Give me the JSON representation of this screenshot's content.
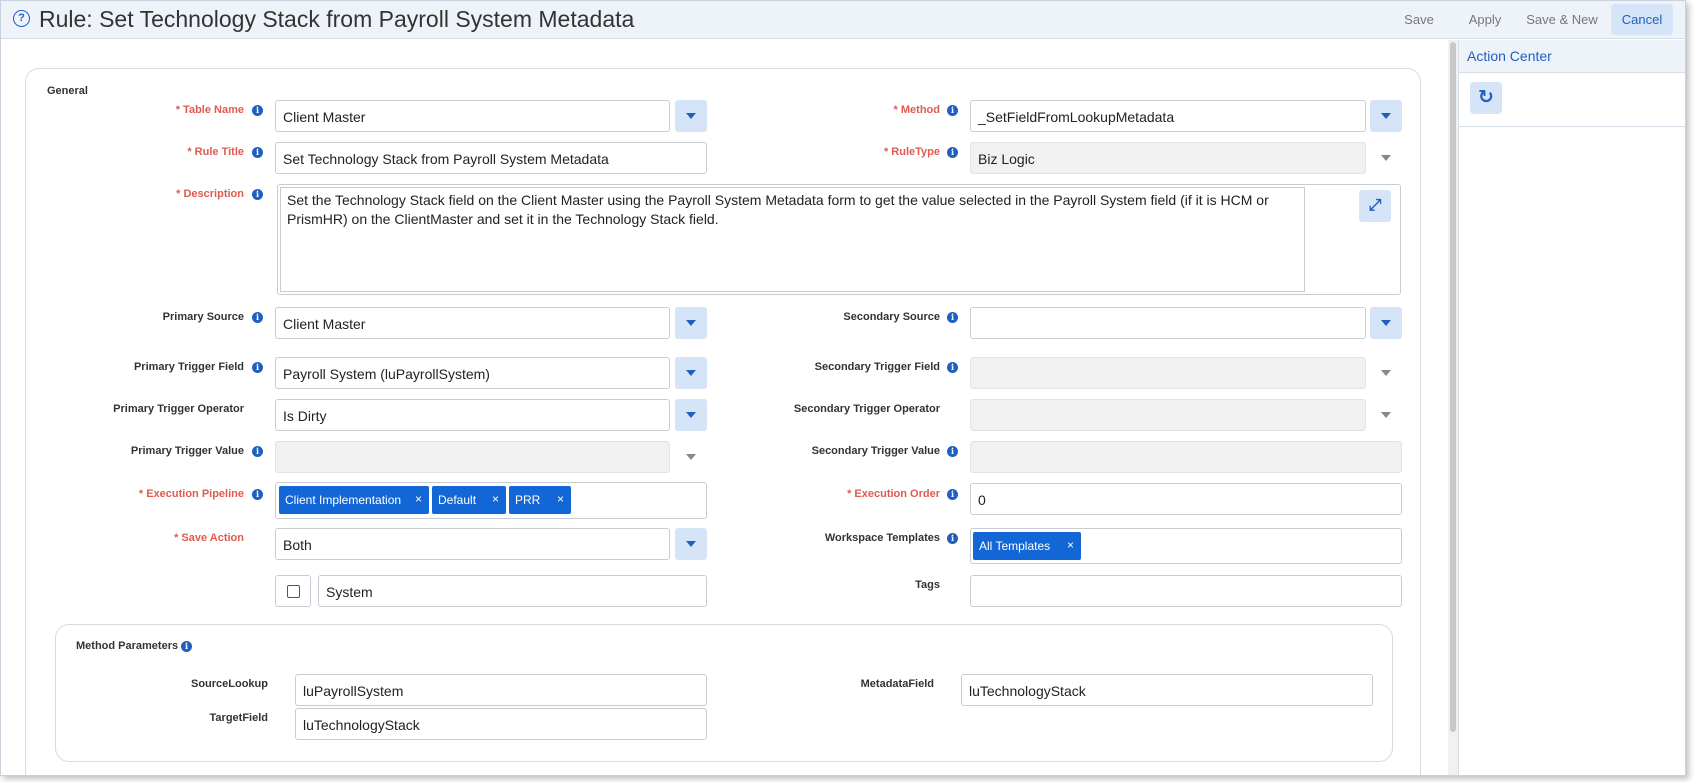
{
  "header": {
    "title": "Rule: Set Technology Stack from Payroll System Metadata",
    "buttons": {
      "save": "Save",
      "apply": "Apply",
      "save_new": "Save & New",
      "cancel": "Cancel"
    }
  },
  "side_panel": {
    "title": "Action Center"
  },
  "general": {
    "section_title": "General",
    "table_name": {
      "label": "* Table Name",
      "value": "Client Master"
    },
    "method": {
      "label": "* Method",
      "value": "_SetFieldFromLookupMetadata"
    },
    "rule_title": {
      "label": "* Rule Title",
      "value": "Set Technology Stack from Payroll System Metadata"
    },
    "rule_type": {
      "label": "* RuleType",
      "value": "Biz Logic"
    },
    "description": {
      "label": "* Description",
      "value": "Set the Technology Stack field on the Client Master using the Payroll System Metadata form to get the value selected in the Payroll System field (if it is HCM or PrismHR) on the ClientMaster and set it in the Technology Stack field."
    },
    "primary_source": {
      "label": "Primary Source",
      "value": "Client Master"
    },
    "secondary_source": {
      "label": "Secondary Source",
      "value": ""
    },
    "primary_trigger_field": {
      "label": "Primary Trigger Field",
      "value": "Payroll System (luPayrollSystem)"
    },
    "secondary_trigger_field": {
      "label": "Secondary Trigger Field",
      "value": ""
    },
    "primary_trigger_operator": {
      "label": "Primary Trigger Operator",
      "value": "Is Dirty"
    },
    "secondary_trigger_operator": {
      "label": "Secondary Trigger Operator",
      "value": ""
    },
    "primary_trigger_value": {
      "label": "Primary Trigger Value",
      "value": ""
    },
    "secondary_trigger_value": {
      "label": "Secondary Trigger Value",
      "value": ""
    },
    "execution_pipeline": {
      "label": "* Execution Pipeline",
      "chips": [
        "Client Implementation",
        "Default",
        "PRR"
      ]
    },
    "execution_order": {
      "label": "* Execution Order",
      "value": "0"
    },
    "save_action": {
      "label": "* Save Action",
      "value": "Both"
    },
    "workspace_templates": {
      "label": "Workspace Templates",
      "chips": [
        "All Templates"
      ]
    },
    "system": {
      "value": "System",
      "checked": false
    },
    "tags": {
      "label": "Tags",
      "value": ""
    }
  },
  "method_parameters": {
    "title": "Method Parameters",
    "source_lookup": {
      "label": "SourceLookup",
      "value": "luPayrollSystem"
    },
    "target_field": {
      "label": "TargetField",
      "value": "luTechnologyStack"
    },
    "metadata_field": {
      "label": "MetadataField",
      "value": "luTechnologyStack"
    }
  },
  "chip_remove_glyph": "×",
  "colors": {
    "accent": "#1f5fbf",
    "chip": "#1366d6",
    "required": "#e05a4f",
    "button_bg": "#d6e4f7"
  }
}
